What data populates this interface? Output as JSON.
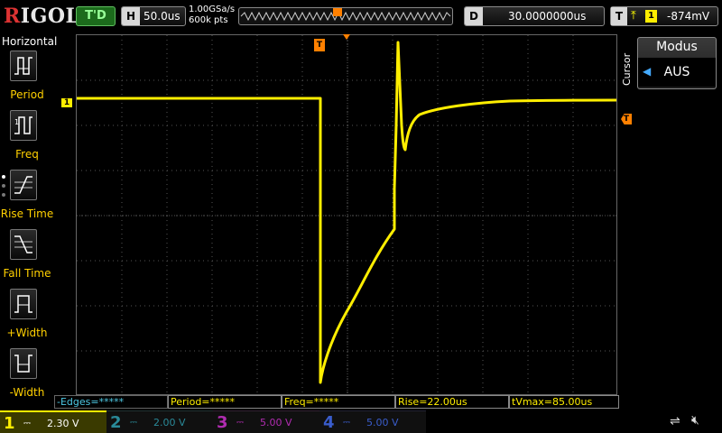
{
  "header": {
    "logo": "RIGOL",
    "run_status": "T'D",
    "timebase_letter": "H",
    "timebase": "50.0us",
    "sample_rate": "1.00GSa/s",
    "memory_depth": "600k pts",
    "delay_letter": "D",
    "delay": "30.0000000us",
    "trigger_letter": "T",
    "trigger_edge": "rising-edge",
    "trigger_edge_symbol": "⤒",
    "trigger_channel": "1",
    "trigger_level": "-874mV"
  },
  "left_menu": {
    "title": "Horizontal",
    "items": [
      {
        "label": "Period",
        "icon": "period-icon"
      },
      {
        "label": "Freq",
        "icon": "freq-icon"
      },
      {
        "label": "Rise Time",
        "icon": "rise-time-icon"
      },
      {
        "label": "Fall Time",
        "icon": "fall-time-icon"
      },
      {
        "label": "+Width",
        "icon": "positive-width-icon"
      },
      {
        "label": "-Width",
        "icon": "negative-width-icon"
      }
    ]
  },
  "right_panel": {
    "tab": "Cursor",
    "mode_title": "Modus",
    "mode_value": "AUS"
  },
  "markers": {
    "trigger_position": "T",
    "channel1": "1",
    "trigger_level": "T"
  },
  "measurements": [
    {
      "text": "-Edges=*****",
      "color": "#4ec9e4"
    },
    {
      "text": "Period=*****",
      "color": "#ffee00"
    },
    {
      "text": "Freq=*****",
      "color": "#ffee00"
    },
    {
      "text": "Rise=22.00us",
      "color": "#ffee00"
    },
    {
      "text": "tVmax=85.00us",
      "color": "#ffee00"
    }
  ],
  "channels": [
    {
      "num": "1",
      "coupling": "⎓",
      "scale": "2.30 V",
      "color": "#ffee00",
      "active": true
    },
    {
      "num": "2",
      "coupling": "⎓",
      "scale": "2.00 V",
      "color": "#2a8a99",
      "active": false
    },
    {
      "num": "3",
      "coupling": "⎓",
      "scale": "5.00 V",
      "color": "#b02cb0",
      "active": false
    },
    {
      "num": "4",
      "coupling": "⎓",
      "scale": "5.00 V",
      "color": "#3a5dcc",
      "active": false
    }
  ],
  "status_icons": [
    "usb-icon",
    "speaker-muted-icon"
  ],
  "colors": {
    "ch1_trace": "#ffee00",
    "trigger": "#ff8000",
    "grid": "#555555",
    "status_green": "#1c6b1c"
  }
}
